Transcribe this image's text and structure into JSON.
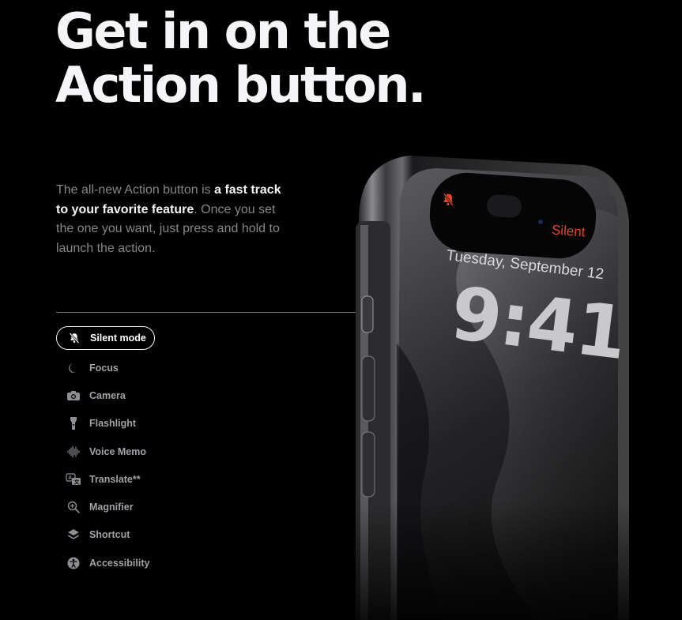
{
  "headline": {
    "line1": "Get in on the",
    "line2": "Action button."
  },
  "intro": {
    "part1": "The all-new Action button is ",
    "bold": "a fast track to your favorite feature",
    "part2": ". Once you set the one you want, just press and hold to launch the action."
  },
  "modes": [
    {
      "label": "Silent mode",
      "icon": "bell-slash-icon",
      "active": true
    },
    {
      "label": "Focus",
      "icon": "moon-icon",
      "active": false
    },
    {
      "label": "Camera",
      "icon": "camera-icon",
      "active": false
    },
    {
      "label": "Flashlight",
      "icon": "flashlight-icon",
      "active": false
    },
    {
      "label": "Voice Memo",
      "icon": "waveform-icon",
      "active": false
    },
    {
      "label": "Translate**",
      "icon": "translate-icon",
      "active": false
    },
    {
      "label": "Magnifier",
      "icon": "magnifier-icon",
      "active": false
    },
    {
      "label": "Shortcut",
      "icon": "shortcut-layers-icon",
      "active": false
    },
    {
      "label": "Accessibility",
      "icon": "accessibility-icon",
      "active": false
    }
  ],
  "phone": {
    "status": "Silent",
    "date": "Tuesday, September 12",
    "time": "9:41",
    "accent_color": "#e8432e"
  }
}
